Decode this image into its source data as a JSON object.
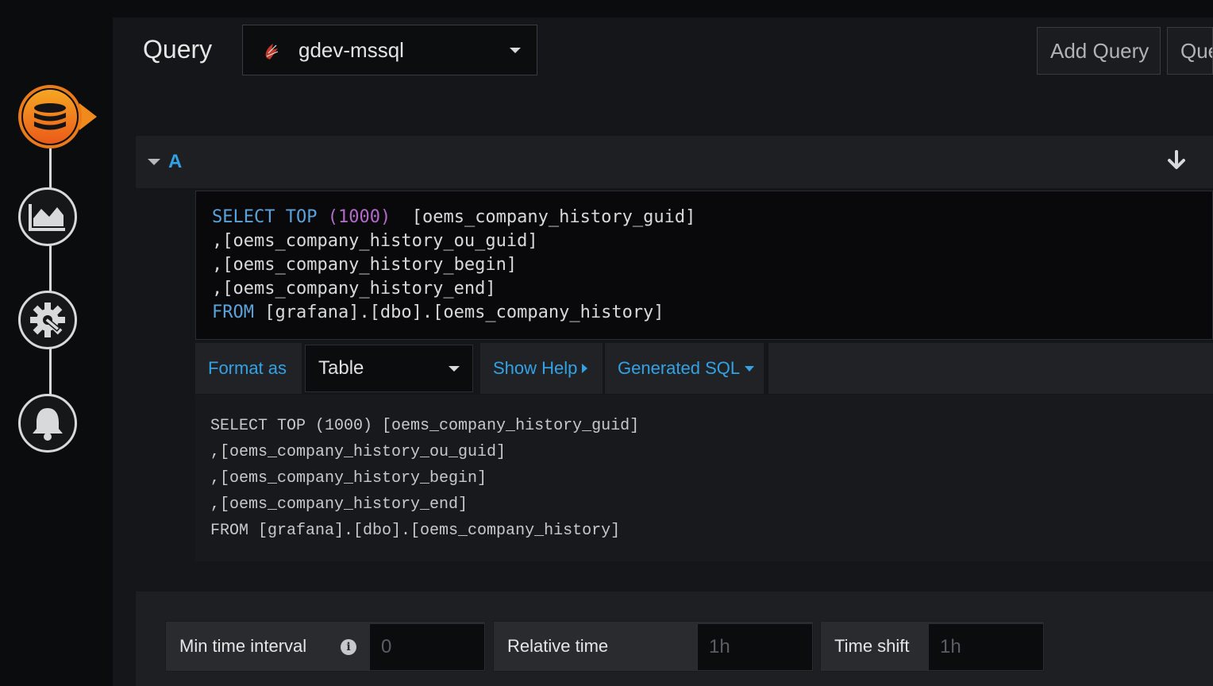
{
  "header": {
    "title": "Query",
    "datasource": {
      "name": "gdev-mssql",
      "icon": "mssql-logo-icon"
    },
    "add_query_label": "Add Query",
    "query_inspector_label": "Que"
  },
  "sidebar": {
    "steps": [
      {
        "name": "queries",
        "icon": "database-icon",
        "active": true
      },
      {
        "name": "visualization",
        "icon": "area-chart-icon",
        "active": false
      },
      {
        "name": "general",
        "icon": "gear-wrench-icon",
        "active": false
      },
      {
        "name": "alert",
        "icon": "bell-icon",
        "active": false
      }
    ]
  },
  "query_row": {
    "ref_id": "A",
    "sql": {
      "line1": {
        "kw1": "SELECT",
        "kw2": "TOP",
        "num": "(1000)",
        "rest": "[oems_company_history_guid]"
      },
      "line2": ",[oems_company_history_ou_guid]",
      "line3": ",[oems_company_history_begin]",
      "line4": ",[oems_company_history_end]",
      "line5": {
        "kw": "FROM",
        "rest": "[grafana].[dbo].[oems_company_history]"
      }
    },
    "toolbar": {
      "format_as_label": "Format as",
      "format_value": "Table",
      "show_help_label": "Show Help",
      "generated_sql_label": "Generated SQL"
    },
    "generated_sql": [
      "SELECT TOP (1000) [oems_company_history_guid]",
      ",[oems_company_history_ou_guid]",
      ",[oems_company_history_begin]",
      ",[oems_company_history_end]",
      "FROM [grafana].[dbo].[oems_company_history]"
    ]
  },
  "options": {
    "min_interval": {
      "label": "Min time interval",
      "placeholder": "0",
      "info": "i"
    },
    "relative_time": {
      "label": "Relative time",
      "placeholder": "1h"
    },
    "time_shift": {
      "label": "Time shift",
      "placeholder": "1h"
    }
  },
  "colors": {
    "accent": "#33a2e5",
    "active_step": "#eb7b18",
    "keyword": "#5aa3da",
    "number": "#b46ac9"
  }
}
